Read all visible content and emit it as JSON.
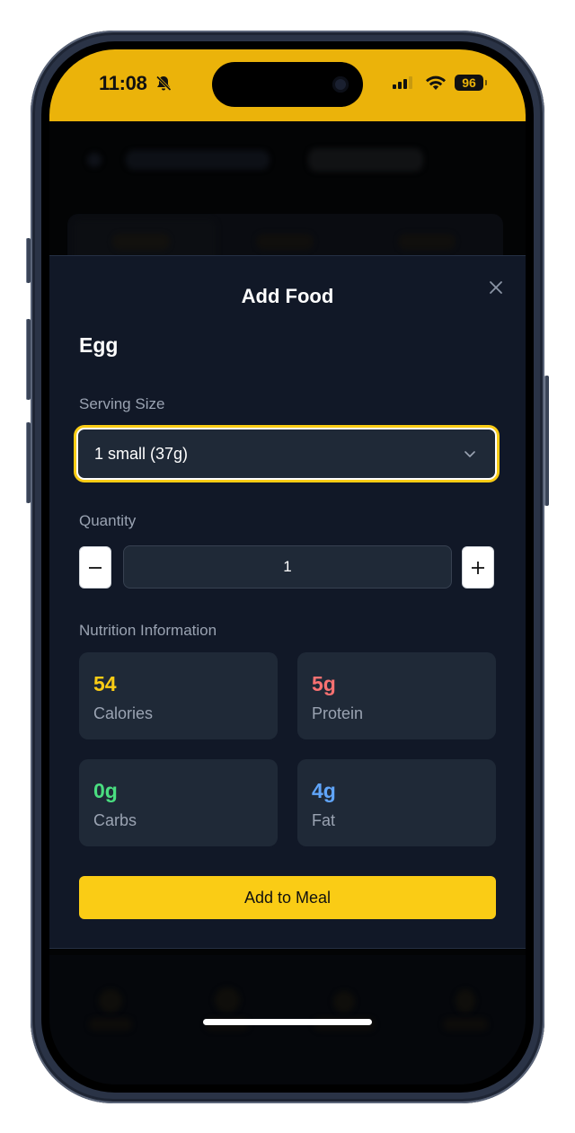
{
  "status_bar": {
    "time": "11:08",
    "battery": "96",
    "icons": [
      "bell-slash-icon",
      "cellular-signal-icon",
      "wifi-icon",
      "battery-icon"
    ]
  },
  "modal": {
    "title": "Add Food",
    "close_icon": "close-icon",
    "food_name": "Egg",
    "serving_size": {
      "label": "Serving Size",
      "selected": "1 small (37g)"
    },
    "quantity": {
      "label": "Quantity",
      "value": "1",
      "decrement_icon": "minus-icon",
      "increment_icon": "plus-icon"
    },
    "nutrition": {
      "label": "Nutrition Information",
      "items": [
        {
          "value": "54",
          "name": "Calories",
          "color": "#facc15"
        },
        {
          "value": "5g",
          "name": "Protein",
          "color": "#f87171"
        },
        {
          "value": "0g",
          "name": "Carbs",
          "color": "#4ade80"
        },
        {
          "value": "4g",
          "name": "Fat",
          "color": "#60a5fa"
        }
      ]
    },
    "primary_button": "Add to Meal"
  },
  "colors": {
    "accent": "#facc15",
    "status_bar_bg": "#ebb30a",
    "modal_bg": "#111827",
    "card_bg": "#1f2937"
  }
}
